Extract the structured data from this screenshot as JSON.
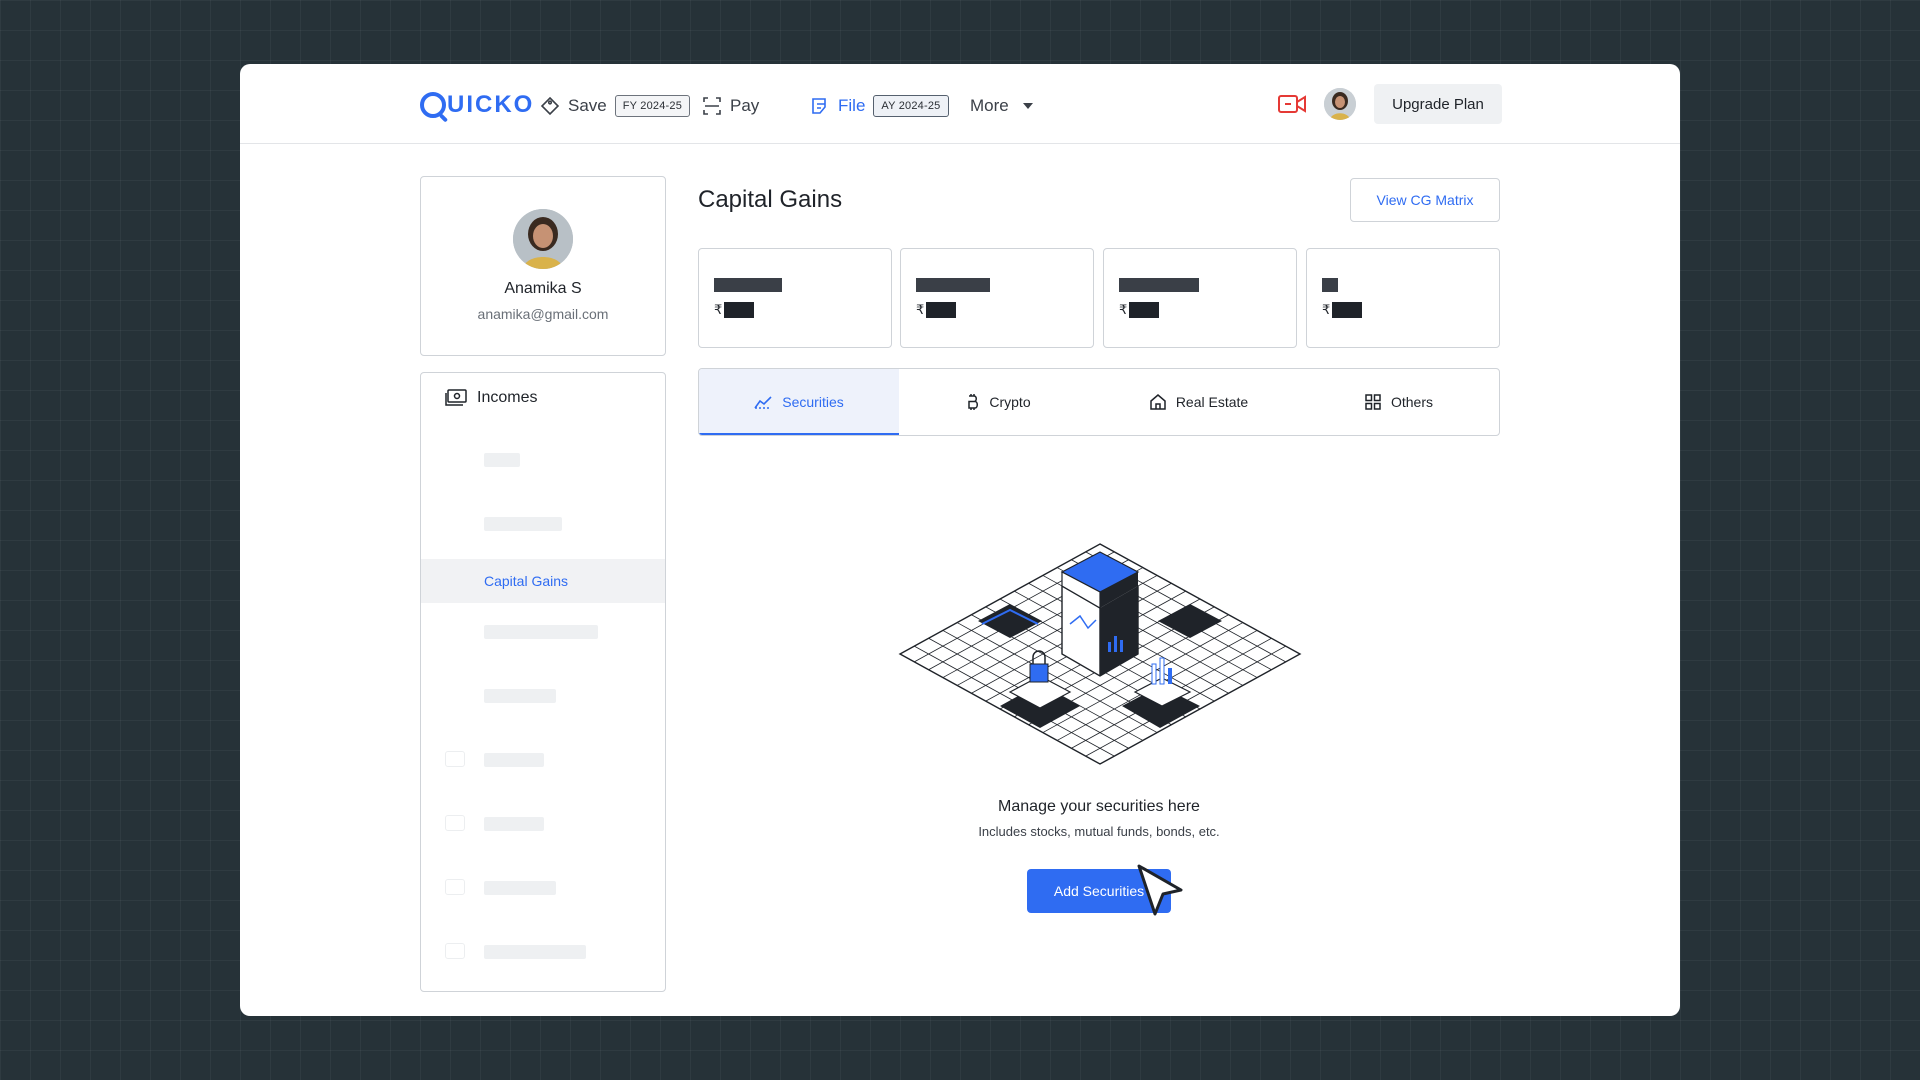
{
  "header": {
    "logo_text": "UICKO",
    "nav": [
      {
        "label": "Save",
        "badge": "FY 2024-25"
      },
      {
        "label": "Pay"
      },
      {
        "label": "File",
        "badge": "AY 2024-25"
      },
      {
        "label": "More"
      }
    ],
    "upgrade_label": "Upgrade Plan"
  },
  "profile": {
    "name": "Anamika S",
    "email": "anamika@gmail.com"
  },
  "sidebar": {
    "heading": "Incomes",
    "active_item": "Capital Gains"
  },
  "main": {
    "title": "Capital Gains",
    "matrix_button": "View CG Matrix",
    "currency_symbol": "₹",
    "tabs": [
      {
        "label": "Securities",
        "icon": "chart-line-icon"
      },
      {
        "label": "Crypto",
        "icon": "bitcoin-icon"
      },
      {
        "label": "Real Estate",
        "icon": "home-icon"
      },
      {
        "label": "Others",
        "icon": "grid-icon"
      }
    ],
    "active_tab": "Securities",
    "empty_title": "Manage your securities here",
    "empty_subtitle": "Includes stocks, mutual funds, bonds, etc.",
    "add_button": "Add Securities"
  },
  "colors": {
    "accent": "#2f6cf2",
    "background": "#263238",
    "video_icon": "#e53935"
  }
}
